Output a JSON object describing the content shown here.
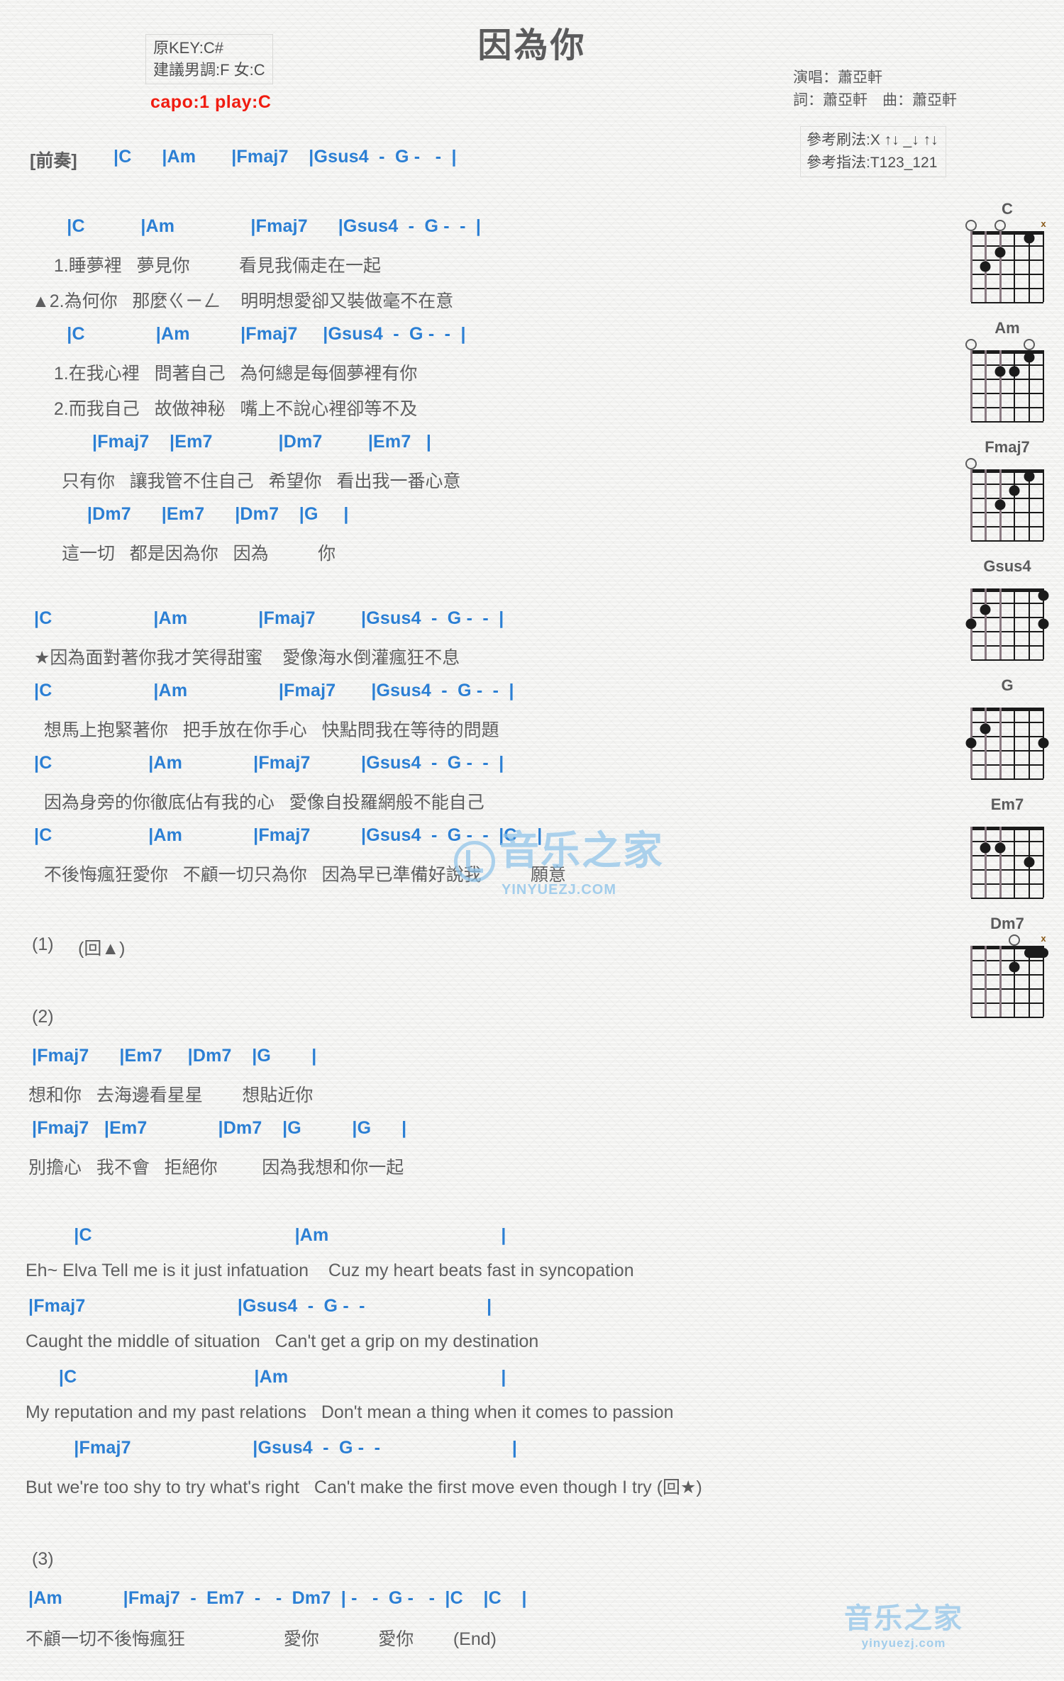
{
  "header": {
    "title": "因為你",
    "orig_key": "原KEY:C#",
    "suggest_key": "建議男調:F 女:C",
    "capo": "capo:1 play:C",
    "singer": "演唱：蕭亞軒",
    "writer": "詞：蕭亞軒　曲：蕭亞軒",
    "strum": "參考刷法:X ↑↓ _↓ ↑↓",
    "fingering": "參考指法:T123_121"
  },
  "colors": {
    "chord": "#2b7fd4",
    "lyric": "#5e5e5f",
    "capo_red": "#f01c10",
    "barline": "#b08d33",
    "watermark": "#8fc4ea"
  },
  "sections": {
    "intro_label": "[前奏]",
    "repeat_1": "(1)",
    "repeat_1_note": "(回▲)",
    "repeat_2": "(2)",
    "repeat_3": "(3)",
    "end_mark": "(End)"
  },
  "lines": {
    "intro_chords": "|C      |Am       |Fmaj7    |Gsus4  -  G -   -  |",
    "v1_chords_a": "  |C           |Am               |Fmaj7      |Gsus4  -  G -  -  |",
    "v1_lyric_1": "  1.睡夢裡   夢見你          看見我倆走在一起",
    "v1_lyric_2": "▲2.為何你   那麼ㄍㄧㄥ    明明想愛卻又裝做毫不在意",
    "v1_chords_b": "  |C              |Am          |Fmaj7     |Gsus4  -  G -  -  |",
    "v1_lyric_3": "  1.在我心裡   問著自己   為何總是每個夢裡有你",
    "v1_lyric_4": "  2.而我自己   故做神秘   嘴上不說心裡卻等不及",
    "pre_chords_a": "       |Fmaj7    |Em7             |Dm7         |Em7   |",
    "pre_lyric_1": " 只有你   讓我管不住自己   希望你   看出我一番心意",
    "pre_chords_b": "      |Dm7      |Em7      |Dm7    |G     |",
    "pre_lyric_2": " 這一切   都是因為你   因為          你",
    "ch_chords_1": "|C                    |Am              |Fmaj7         |Gsus4  -  G -  -  |",
    "ch_lyric_1": "★因為面對著你我才笑得甜蜜    愛像海水倒灌瘋狂不息",
    "ch_chords_2": "|C                    |Am                  |Fmaj7       |Gsus4  -  G -  -  |",
    "ch_lyric_2": "  想馬上抱緊著你   把手放在你手心   快點問我在等待的問題",
    "ch_chords_3": "|C                   |Am              |Fmaj7          |Gsus4  -  G -  -  |",
    "ch_lyric_3": "  因為身旁的你徹底佔有我的心   愛像自投羅網般不能自己",
    "ch_chords_4": "|C                   |Am              |Fmaj7          |Gsus4  -  G -  -  |C    |",
    "ch_lyric_4": "  不後悔瘋狂愛你   不顧一切只為你   因為早已準備好說我          願意",
    "b2_chords_1": "|Fmaj7      |Em7     |Dm7    |G        |",
    "b2_lyric_1": "想和你   去海邊看星星        想貼近你",
    "b2_chords_2": "|Fmaj7   |Em7              |Dm7    |G          |G      |",
    "b2_lyric_2": "別擔心   我不會   拒絕你         因為我想和你一起",
    "en_chords_1": "         |C                                        |Am                                  |",
    "en_lyric_1": "Eh~ Elva Tell me is it just infatuation    Cuz my heart beats fast in syncopation",
    "en_chords_2": "|Fmaj7                              |Gsus4  -  G -  -                        |",
    "en_lyric_2": "Caught the middle of situation   Can't get a grip on my destination",
    "en_chords_3": "      |C                                   |Am                                          |",
    "en_lyric_3": "My reputation and my past relations   Don't mean a thing when it comes to passion",
    "en_chords_4": "         |Fmaj7                        |Gsus4  -  G -  -                          |",
    "en_lyric_4": "But we're too shy to try what's right   Can't make the first move even though I try (回★)",
    "end_chords": "|Am            |Fmaj7  -  Em7  -   -  Dm7  | -   -  G -   -  |C    |C    |",
    "end_lyric": "不顧一切不後悔瘋狂                    愛你            愛你        (End)"
  },
  "chord_diagrams": [
    {
      "name": "C",
      "marks": [
        "x",
        "",
        "",
        "o",
        "",
        "o"
      ],
      "dots": [
        {
          "s": 2,
          "f": 1
        },
        {
          "s": 4,
          "f": 2
        },
        {
          "s": 5,
          "f": 3
        }
      ]
    },
    {
      "name": "Am",
      "marks": [
        "",
        "o",
        "",
        "",
        "",
        "o"
      ],
      "dots": [
        {
          "s": 2,
          "f": 1
        },
        {
          "s": 3,
          "f": 2
        },
        {
          "s": 4,
          "f": 2
        }
      ]
    },
    {
      "name": "Fmaj7",
      "marks": [
        "",
        "",
        "",
        "",
        "",
        "o"
      ],
      "dots": [
        {
          "s": 2,
          "f": 1
        },
        {
          "s": 3,
          "f": 2
        },
        {
          "s": 4,
          "f": 3
        }
      ]
    },
    {
      "name": "Gsus4",
      "marks": [
        "",
        "",
        "",
        "",
        "",
        ""
      ],
      "dots": [
        {
          "s": 1,
          "f": 1
        },
        {
          "s": 5,
          "f": 2
        },
        {
          "s": 6,
          "f": 3
        },
        {
          "s": 1,
          "f": 3
        }
      ]
    },
    {
      "name": "G",
      "marks": [
        "",
        "",
        "",
        "",
        "",
        ""
      ],
      "dots": [
        {
          "s": 5,
          "f": 2
        },
        {
          "s": 6,
          "f": 3
        },
        {
          "s": 1,
          "f": 3
        }
      ]
    },
    {
      "name": "Em7",
      "marks": [
        "",
        "",
        "",
        "",
        "",
        ""
      ],
      "dots": [
        {
          "s": 5,
          "f": 2
        },
        {
          "s": 4,
          "f": 2
        },
        {
          "s": 2,
          "f": 3
        }
      ]
    },
    {
      "name": "Dm7",
      "marks": [
        "x",
        "",
        "o",
        "",
        "",
        ""
      ],
      "dots": [
        {
          "s": 3,
          "f": 2
        }
      ],
      "barre": {
        "from": 1,
        "to": 2,
        "f": 1
      }
    }
  ],
  "watermark": {
    "main": "音乐之家",
    "sub": "YINYUEZJ.COM",
    "bottom_main": "音乐之家",
    "bottom_sub": "yinyuezj.com"
  }
}
